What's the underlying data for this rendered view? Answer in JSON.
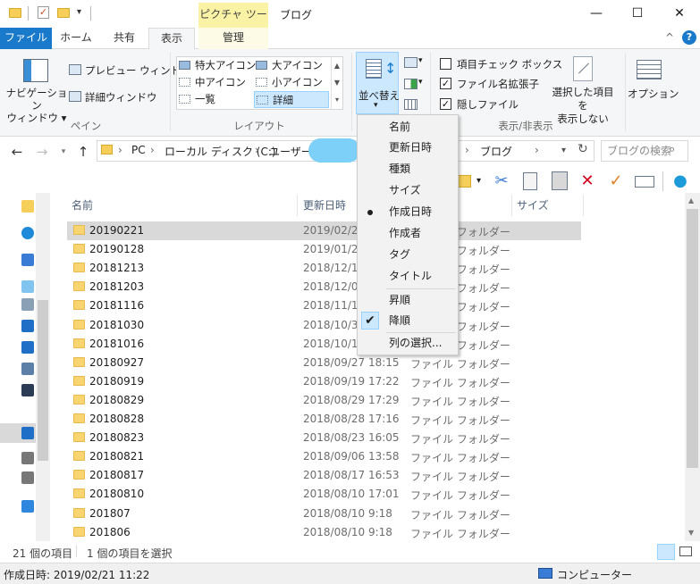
{
  "title_bar": {
    "context_tab_header": "ピクチャ ツール",
    "window_title": "ブログ",
    "minimize": "—",
    "maximize": "☐",
    "close": "✕"
  },
  "tabs": [
    {
      "label": "ファイル"
    },
    {
      "label": "ホーム"
    },
    {
      "label": "共有"
    },
    {
      "label": "表示"
    },
    {
      "label": "管理"
    }
  ],
  "ribbon": {
    "pane_group": {
      "navigation_pane": "ナビゲーション\nウィンドウ ▾",
      "preview_pane": "プレビュー ウィンドウ",
      "details_pane": "詳細ウィンドウ",
      "label": "ペイン"
    },
    "layout_group": {
      "items": [
        "特大アイコン",
        "大アイコン",
        "中アイコン",
        "小アイコン",
        "一覧",
        "詳細"
      ],
      "selected": "詳細",
      "label": "レイアウト"
    },
    "sort_button": "並べ替え",
    "show_hide_group": {
      "item_checkboxes": "項目チェック ボックス",
      "file_extensions": "ファイル名拡張子",
      "hidden_files": "隠しファイル",
      "item_checkboxes_checked": false,
      "file_extensions_checked": true,
      "hidden_files_checked": true,
      "hide_selected": "選択した項目を\n表示しない",
      "label": "表示/非表示"
    },
    "options": "オプション",
    "collapse_icon": "^",
    "help_icon": "?"
  },
  "address_bar": {
    "crumbs": [
      "PC",
      "ローカル ディスク (C:)",
      "ユーザー",
      "ブログ"
    ],
    "search_placeholder": "ブログの検索"
  },
  "sort_menu": {
    "sort_by": [
      "名前",
      "更新日時",
      "種類",
      "サイズ",
      "作成日時",
      "作成者",
      "タグ",
      "タイトル"
    ],
    "selected_sort": "作成日時",
    "order": [
      "昇順",
      "降順"
    ],
    "selected_order": "降順",
    "choose_columns": "列の選択..."
  },
  "file_list": {
    "columns": {
      "name": "名前",
      "modified": "更新日時",
      "type": "種類",
      "size": "サイズ"
    },
    "rows": [
      {
        "name": "20190221",
        "date": "2019/02/21",
        "type": "ファイル フォルダー",
        "selected": true
      },
      {
        "name": "20190128",
        "date": "2019/01/28",
        "type": "ファイル フォルダー"
      },
      {
        "name": "20181213",
        "date": "2018/12/13",
        "type": "ファイル フォルダー"
      },
      {
        "name": "20181203",
        "date": "2018/12/03",
        "type": "ファイル フォルダー"
      },
      {
        "name": "20181116",
        "date": "2018/11/19",
        "type": "ファイル フォルダー"
      },
      {
        "name": "20181030",
        "date": "2018/10/30",
        "type": "ファイル フォルダー"
      },
      {
        "name": "20181016",
        "date": "2018/10/16",
        "type": "ファイル フォルダー"
      },
      {
        "name": "20180927",
        "date": "2018/09/27 18:15",
        "type": "ファイル フォルダー"
      },
      {
        "name": "20180919",
        "date": "2018/09/19 17:22",
        "type": "ファイル フォルダー"
      },
      {
        "name": "20180829",
        "date": "2018/08/29 17:29",
        "type": "ファイル フォルダー"
      },
      {
        "name": "20180828",
        "date": "2018/08/28 17:16",
        "type": "ファイル フォルダー"
      },
      {
        "name": "20180823",
        "date": "2018/08/23 16:05",
        "type": "ファイル フォルダー"
      },
      {
        "name": "20180821",
        "date": "2018/09/06 13:58",
        "type": "ファイル フォルダー"
      },
      {
        "name": "20180817",
        "date": "2018/08/17 16:53",
        "type": "ファイル フォルダー"
      },
      {
        "name": "20180810",
        "date": "2018/08/10 17:01",
        "type": "ファイル フォルダー"
      },
      {
        "name": "201807",
        "date": "2018/08/10 9:18",
        "type": "ファイル フォルダー"
      },
      {
        "name": "201806",
        "date": "2018/08/10 9:18",
        "type": "ファイル フォルダー"
      }
    ]
  },
  "status": {
    "item_count": "21 個の項目",
    "selected_count": "1 個の項目を選択",
    "details_created": "作成日時: 2019/02/21 11:22",
    "computer": "コンピューター"
  },
  "colors": {
    "file_tab": "#1979ca",
    "context_tab": "#faf2a4",
    "selection": "#cce8ff",
    "folder": "#f9d572"
  }
}
